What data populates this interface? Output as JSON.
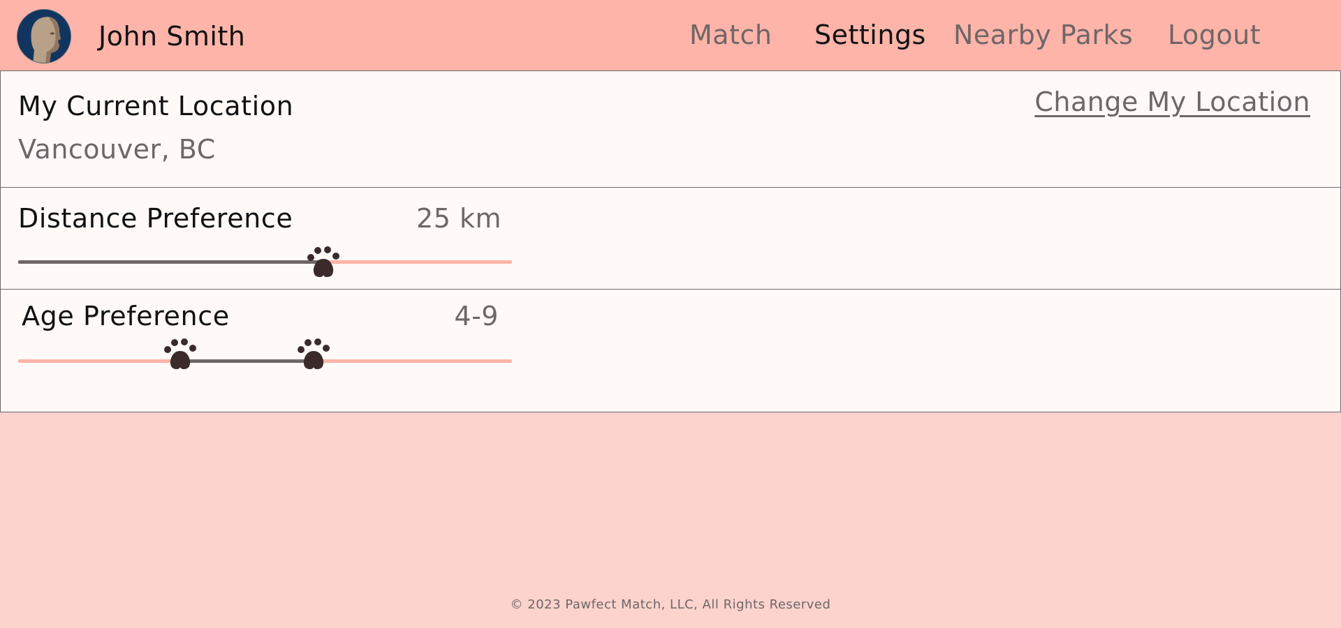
{
  "header": {
    "user_name": "John Smith",
    "nav": {
      "match": "Match",
      "settings": "Settings",
      "nearby_parks": "Nearby Parks",
      "logout": "Logout"
    },
    "active_tab": "Settings"
  },
  "location": {
    "title": "My Current Location",
    "value": "Vancouver, BC",
    "change_link": "Change My Location"
  },
  "distance": {
    "title": "Distance Preference",
    "value": "25 km",
    "slider_fraction": 0.62
  },
  "age": {
    "title": "Age Preference",
    "value": "4-9",
    "range_fraction": [
      0.33,
      0.6
    ]
  },
  "footer": {
    "text": "© 2023 Pawfect Match, LLC, All Rights Reserved"
  },
  "colors": {
    "header_bg": "#feb4a9",
    "page_bg": "#fcd3cd",
    "panel_bg": "#fff9f8",
    "accent_dark": "#3a2a2a",
    "muted_text": "#6f6668"
  },
  "icons": {
    "avatar": "user-avatar-icon",
    "slider_handle": "paw-icon"
  }
}
